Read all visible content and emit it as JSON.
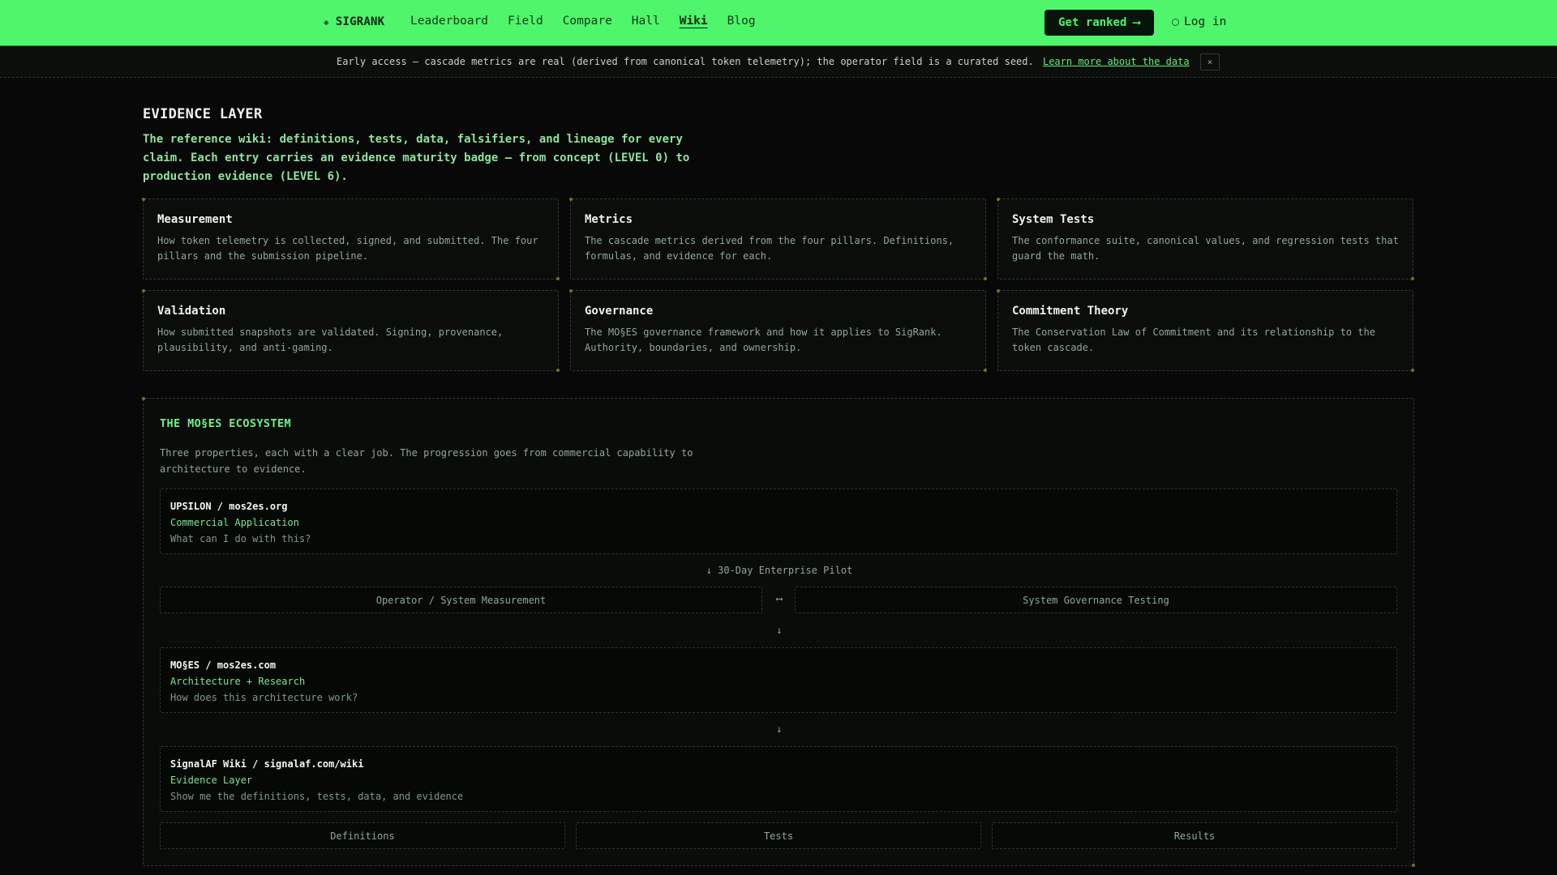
{
  "nav": {
    "brand": "SIGRANK",
    "brand_icon": "diamond-icon",
    "links": [
      "Leaderboard",
      "Field",
      "Compare",
      "Hall",
      "Wiki",
      "Blog"
    ],
    "active": "Wiki",
    "cta_label": "Get ranked",
    "cta_arrow": "⟶",
    "login_label": "Log in"
  },
  "banner": {
    "text": "Early access — cascade metrics are real (derived from canonical token telemetry); the operator field is a curated seed.",
    "link": "Learn more about the data",
    "close": "×"
  },
  "header": {
    "title": "EVIDENCE LAYER",
    "intro": "The reference wiki: definitions, tests, data, falsifiers, and lineage for every claim. Each entry carries an evidence maturity badge — from concept (LEVEL 0) to production evidence (LEVEL 6)."
  },
  "cards": [
    {
      "title": "Measurement",
      "desc": "How token telemetry is collected, signed, and submitted. The four pillars and the submission pipeline."
    },
    {
      "title": "Metrics",
      "desc": "The cascade metrics derived from the four pillars. Definitions, formulas, and evidence for each."
    },
    {
      "title": "System Tests",
      "desc": "The conformance suite, canonical values, and regression tests that guard the math."
    },
    {
      "title": "Validation",
      "desc": "How submitted snapshots are validated. Signing, provenance, plausibility, and anti-gaming."
    },
    {
      "title": "Governance",
      "desc": "The MO§ES governance framework and how it applies to SigRank. Authority, boundaries, and ownership."
    },
    {
      "title": "Commitment Theory",
      "desc": "The Conservation Law of Commitment and its relationship to the token cascade."
    }
  ],
  "ecosystem": {
    "title": "THE MO§ES ECOSYSTEM",
    "desc": "Three properties, each with a clear job. The progression goes from commercial capability to architecture to evidence.",
    "tiers": [
      {
        "name": "UPSILON / mos2es.org",
        "role": "Commercial Application",
        "question": "What can I do with this?"
      },
      {
        "name": "MO§ES / mos2es.com",
        "role": "Architecture + Research",
        "question": "How does this architecture work?"
      },
      {
        "name": "SignalAF Wiki / signalaf.com/wiki",
        "role": "Evidence Layer",
        "question": "Show me the definitions, tests, data, and evidence"
      }
    ],
    "pilot_label": "↓ 30-Day Enterprise Pilot",
    "left_box": "Operator / System Measurement",
    "right_box": "System Governance Testing",
    "bidir_arrow": "⟷",
    "down_arrow": "↓",
    "bottom_boxes": [
      "Definitions",
      "Tests",
      "Results"
    ]
  }
}
